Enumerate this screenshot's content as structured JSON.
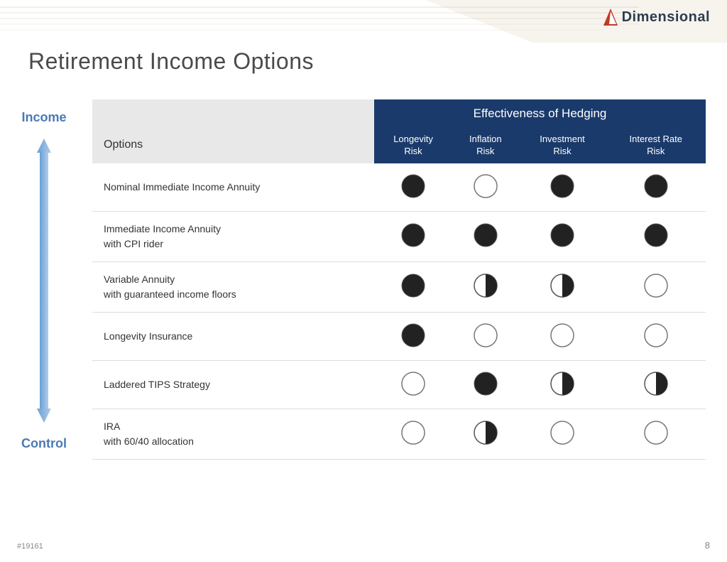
{
  "logo": {
    "text": "Dimensional"
  },
  "page": {
    "title": "Retirement Income Options",
    "footer_id": "#19161",
    "page_number": "8"
  },
  "table": {
    "effectiveness_header": "Effectiveness of Hedging",
    "options_label": "Options",
    "columns": [
      {
        "label": "Longevity\nRisk",
        "key": "longevity"
      },
      {
        "label": "Inflation\nRisk",
        "key": "inflation"
      },
      {
        "label": "Investment\nRisk",
        "key": "investment"
      },
      {
        "label": "Interest Rate\nRisk",
        "key": "interest_rate"
      }
    ],
    "rows": [
      {
        "name": "Nominal Immediate Income Annuity",
        "longevity": "full",
        "inflation": "empty",
        "investment": "full",
        "interest_rate": "full"
      },
      {
        "name": "Immediate Income Annuity\nwith CPI rider",
        "longevity": "full",
        "inflation": "full",
        "investment": "full",
        "interest_rate": "full"
      },
      {
        "name": "Variable Annuity\nwith guaranteed income floors",
        "longevity": "full",
        "inflation": "half",
        "investment": "half",
        "interest_rate": "empty"
      },
      {
        "name": "Longevity Insurance",
        "longevity": "full",
        "inflation": "empty",
        "investment": "empty",
        "interest_rate": "empty"
      },
      {
        "name": "Laddered TIPS Strategy",
        "longevity": "empty",
        "inflation": "full",
        "investment": "half",
        "interest_rate": "half"
      },
      {
        "name": "IRA\nwith 60/40 allocation",
        "longevity": "empty",
        "inflation": "half",
        "investment": "empty",
        "interest_rate": "empty"
      }
    ]
  },
  "arrow": {
    "income_label": "Income",
    "control_label": "Control"
  }
}
